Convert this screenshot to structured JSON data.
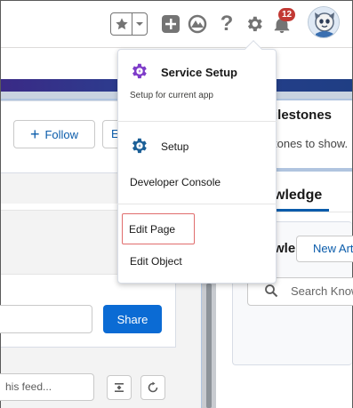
{
  "header": {
    "notification_count": "12",
    "help_glyph": "?",
    "icons": [
      "star-icon",
      "chevron-down-icon",
      "plus-icon",
      "trailhead-icon",
      "help-icon",
      "gear-icon",
      "bell-icon",
      "avatar"
    ]
  },
  "record": {
    "follow_label": "Follow",
    "edit_button_partial": "E"
  },
  "feed": {
    "share_label": "Share",
    "search_placeholder": "his feed..."
  },
  "milestones": {
    "title": "ilestones",
    "empty_text": "tones to show."
  },
  "knowledge": {
    "tab_label": "wledge",
    "panel_title": "wle",
    "new_article_label": "New Art",
    "search_placeholder": "Search Know"
  },
  "setup_menu": {
    "service_setup_title": "Service Setup",
    "service_setup_subtitle": "Setup for current app",
    "setup_label": "Setup",
    "developer_console_label": "Developer Console",
    "edit_page_label": "Edit Page",
    "edit_object_label": "Edit Object"
  },
  "colors": {
    "brand_blue": "#0b5cab",
    "share_button": "#0b6bd4",
    "service_setup_icon": "#7e3cc9",
    "setup_icon": "#1b5f97",
    "badge": "#c23934",
    "highlight_box": "#e06d6d"
  }
}
